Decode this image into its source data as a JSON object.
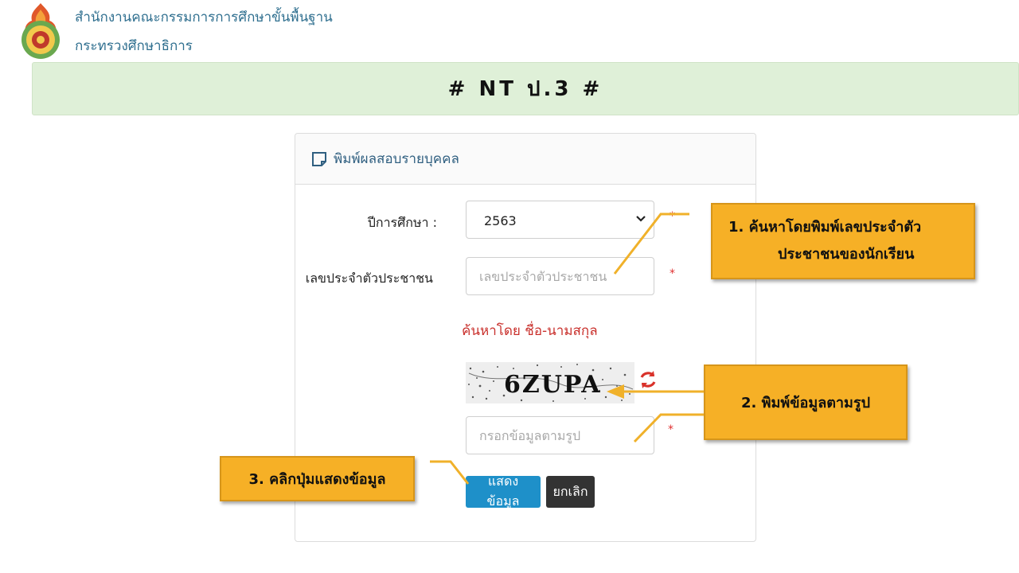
{
  "header": {
    "org_line1": "สำนักงานคณะกรรมการการศึกษาขั้นพื้นฐาน",
    "org_line2": "กระทรวงศึกษาธิการ"
  },
  "banner": {
    "title": "#  NT  ป.3  #"
  },
  "panel": {
    "title": "พิมพ์ผลสอบรายบุคคล",
    "year_label": "ปีการศึกษา  :",
    "year_value": "2563",
    "id_label": "เลขประจำตัวประชาชน",
    "id_placeholder": "เลขประจำตัวประชาชน",
    "search_by_name": "ค้นหาโดย  ชื่อ-นามสกุล",
    "captcha_text": "6ZUPA",
    "captcha_placeholder": "กรอกข้อมูลตามรูป",
    "required_mark": "*",
    "show_button": "แสดงข้อมูล",
    "cancel_button": "ยกเลิก"
  },
  "callouts": {
    "c1_line1": "1.   ค้นหาโดยพิมพ์เลขประจำตัว",
    "c1_line2": "ประชาชนของนักเรียน",
    "c2": "2. พิมพ์ข้อมูลตามรูป",
    "c3": "3. คลิกปุ่มแสดงข้อมูล"
  },
  "colors": {
    "banner_bg": "#dff0d8",
    "primary_button": "#1e90c9",
    "cancel_button": "#333333",
    "callout": "#f6b026",
    "required": "#e03030",
    "link_red": "#c9302c"
  },
  "icons": [
    "emblem-logo",
    "note-icon",
    "chevron-down-icon",
    "refresh-icon"
  ]
}
